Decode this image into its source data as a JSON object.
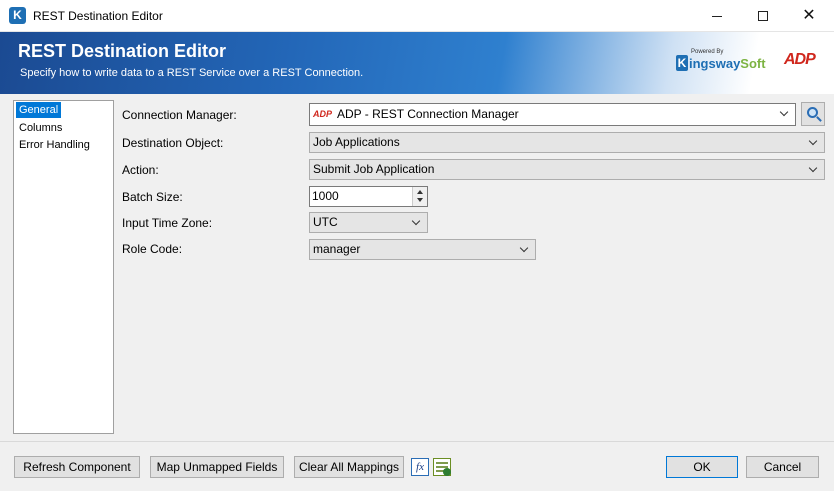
{
  "window": {
    "title": "REST Destination Editor",
    "app_icon_letter": "K"
  },
  "banner": {
    "title": "REST Destination Editor",
    "subtitle": "Specify how to write data to a REST Service over a REST Connection.",
    "kingsway_powered": "Powered By",
    "kingsway_k": "K",
    "kingsway_name_1": "ingsway",
    "kingsway_name_2": "Soft",
    "adp_logo": "ADP"
  },
  "nav": {
    "items": [
      {
        "label": "General",
        "selected": true
      },
      {
        "label": "Columns",
        "selected": false
      },
      {
        "label": "Error Handling",
        "selected": false
      }
    ]
  },
  "form": {
    "connection_manager": {
      "label": "Connection Manager:",
      "prefix": "ADP",
      "value": "ADP - REST Connection Manager"
    },
    "destination_object": {
      "label": "Destination Object:",
      "value": "Job Applications"
    },
    "action": {
      "label": "Action:",
      "value": "Submit Job Application"
    },
    "batch_size": {
      "label": "Batch Size:",
      "value": "1000"
    },
    "input_time_zone": {
      "label": "Input Time Zone:",
      "value": "UTC"
    },
    "role_code": {
      "label": "Role Code:",
      "value": "manager"
    }
  },
  "footer": {
    "refresh": "Refresh Component",
    "map_unmapped": "Map Unmapped Fields",
    "clear_mappings": "Clear All Mappings",
    "fx": "fx",
    "ok": "OK",
    "cancel": "Cancel"
  },
  "icons": {
    "app": "kingsway-k-icon",
    "search": "search-icon",
    "expression": "fx-icon",
    "grid": "grid-check-icon"
  },
  "colors": {
    "selection": "#0078d7",
    "banner": "#2367b8",
    "adp_red": "#d0271d"
  }
}
